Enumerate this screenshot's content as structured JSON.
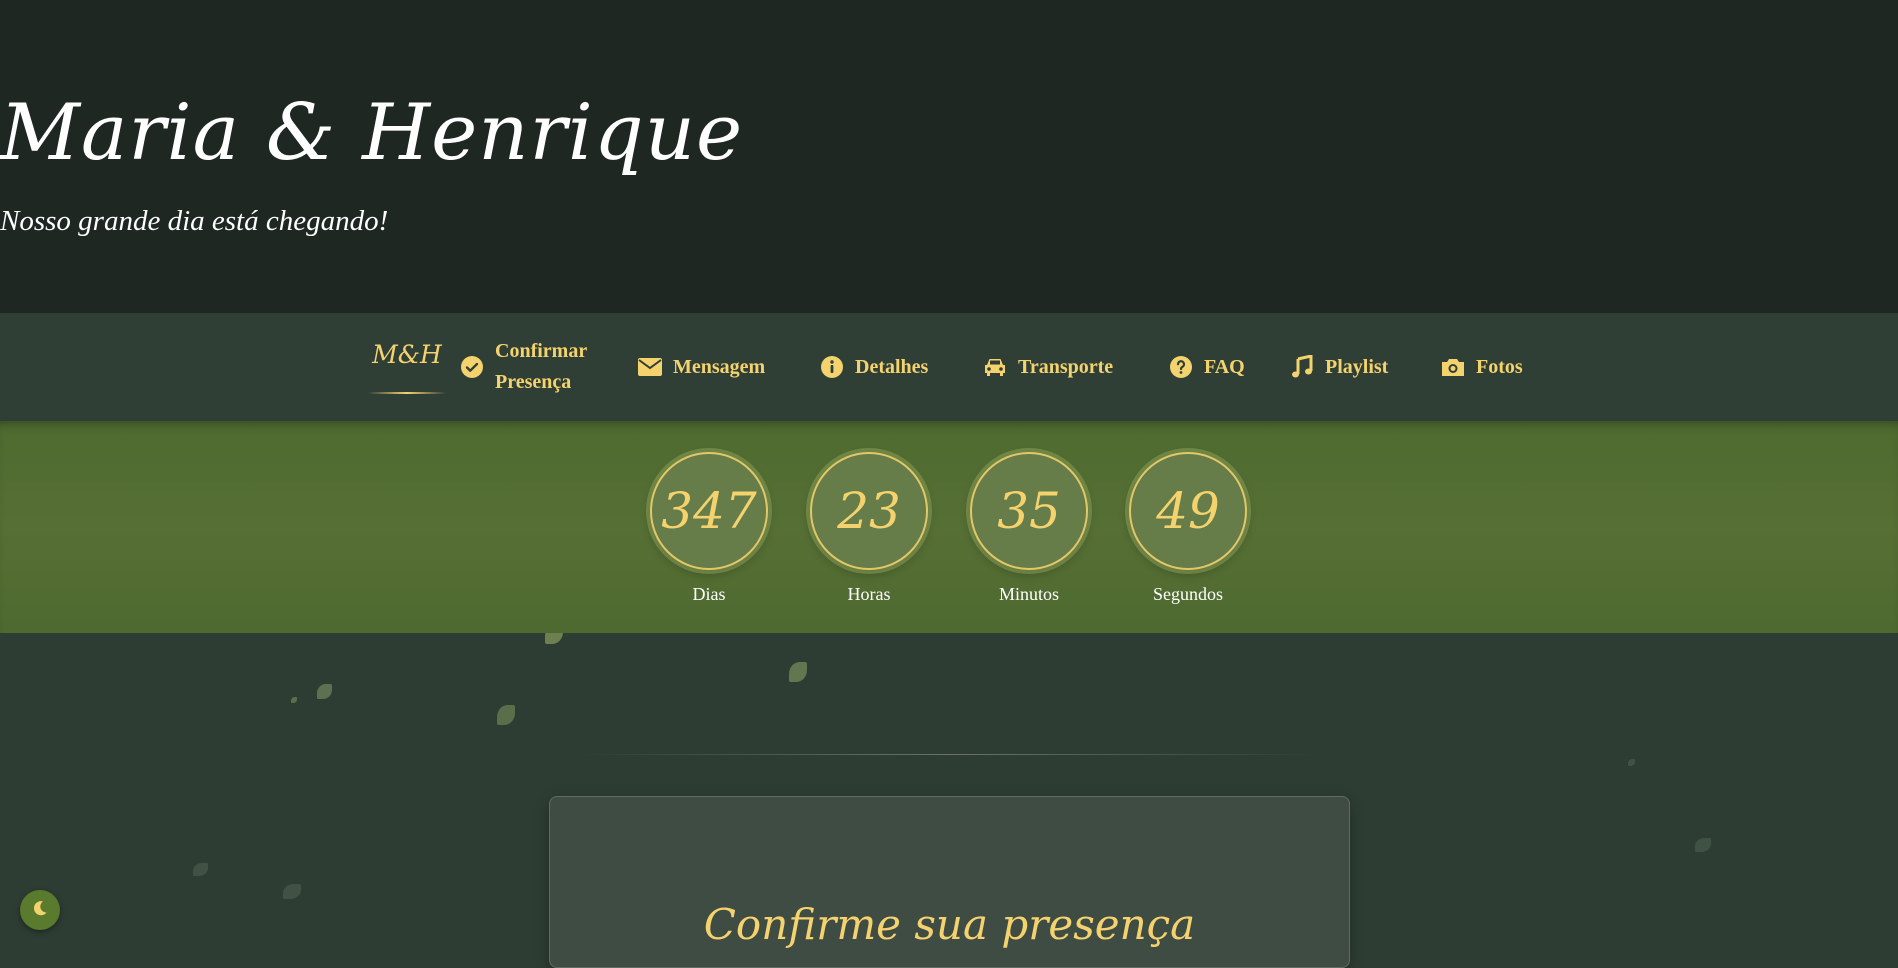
{
  "header": {
    "title": "Maria & Henrique",
    "subtitle": "Nosso grande dia está chegando!"
  },
  "nav": {
    "logo": "M&H",
    "items": [
      {
        "label": "Confirmar Presença",
        "icon": "check-circle-icon"
      },
      {
        "label": "Mensagem",
        "icon": "envelope-icon"
      },
      {
        "label": "Detalhes",
        "icon": "info-circle-icon"
      },
      {
        "label": "Transporte",
        "icon": "car-icon"
      },
      {
        "label": "FAQ",
        "icon": "question-circle-icon"
      },
      {
        "label": "Playlist",
        "icon": "music-note-icon"
      },
      {
        "label": "Fotos",
        "icon": "camera-icon"
      }
    ]
  },
  "countdown": {
    "days": {
      "value": "347",
      "label": "Dias"
    },
    "hours": {
      "value": "23",
      "label": "Horas"
    },
    "minutes": {
      "value": "35",
      "label": "Minutos"
    },
    "seconds": {
      "value": "49",
      "label": "Segundos"
    }
  },
  "rsvp": {
    "title": "Confirme sua presença"
  },
  "theme_toggle": {
    "icon": "moon-icon"
  },
  "colors": {
    "accent": "#f4d36f",
    "header_bg": "#1e2722",
    "nav_bg": "#2f3f36",
    "countdown_bg": "#566f34",
    "page_bg": "#2e3d33"
  }
}
